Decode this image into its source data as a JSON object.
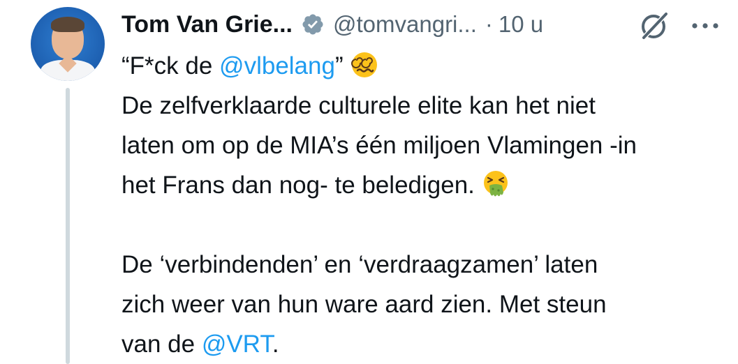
{
  "author": {
    "name": "Tom Van Grie...",
    "handle": "@tomvangri...",
    "separator": "·",
    "time": "10 u",
    "avatar_icon": "profile-photo"
  },
  "icons": {
    "verified": "verified-badge-icon",
    "grok": "grok-icon",
    "more": "more-options-icon",
    "emoji_1": "woozy-dizzy-face-emoji",
    "emoji_2": "vomiting-face-emoji"
  },
  "tweet": {
    "line1": {
      "pre": "“F*ck de ",
      "mention": "@vlbelang",
      "post": "”"
    },
    "line2": "De zelfverklaarde culturele elite kan het niet",
    "line3": "laten om op de MIA’s één miljoen Vlamingen -in",
    "line4": "het Frans dan nog- te beledigen.",
    "line5": "De ‘verbindenden’ en ‘verdraagzamen’ laten",
    "line6": "zich weer van hun ware aard zien. Met steun",
    "line7": {
      "pre": "van de ",
      "mention": "@VRT",
      "post": "."
    }
  },
  "colors": {
    "text": "#0f1419",
    "secondary": "#536471",
    "link": "#1d9bf0",
    "thread_line": "#cfd9de"
  }
}
